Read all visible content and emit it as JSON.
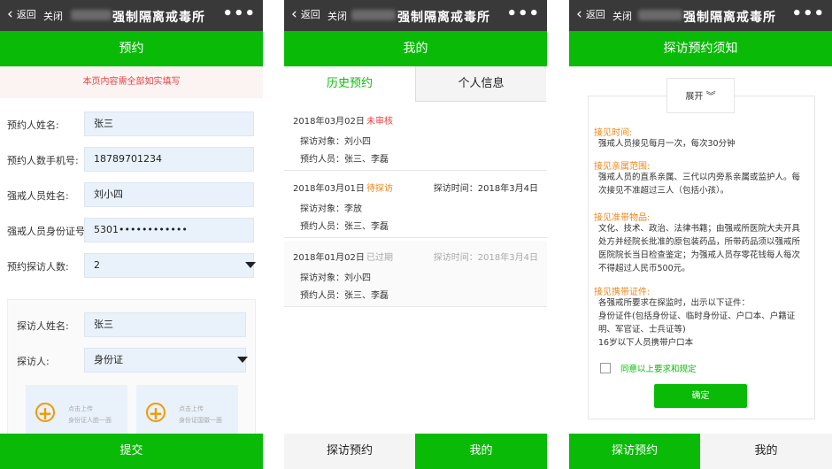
{
  "common": {
    "back": "返回",
    "close": "关闭",
    "window_title": "强制隔离戒毒所",
    "more": "•••"
  },
  "panel1": {
    "header": "预约",
    "notice": "本页内容需全部如实填写",
    "fields": [
      {
        "label": "预约人姓名:",
        "value": "张三"
      },
      {
        "label": "预约人数手机号:",
        "value": "18789701234"
      },
      {
        "label": "强戒人员姓名:",
        "value": "刘小四"
      },
      {
        "label": "强戒人员身份证号:",
        "value": "5301••••••••••••"
      },
      {
        "label": "预约探访人数:",
        "value": "2"
      }
    ],
    "visitor": {
      "name_label": "探访人姓名:",
      "name_value": "张三",
      "type_label": "探访人:",
      "type_value": "身份证",
      "uploads": [
        {
          "line1": "点击上传",
          "line2": "身份证人脸一面"
        },
        {
          "line1": "点击上传",
          "line2": "身份证国徽一面"
        }
      ]
    },
    "submit": "提交"
  },
  "panel2": {
    "header": "我的",
    "tabs": [
      "历史预约",
      "个人信息"
    ],
    "records": [
      {
        "date": "2018年03月02日",
        "status": "未审核",
        "status_color": "#e64340",
        "visit_time": "",
        "target": "探访对象：刘小四",
        "people": "预约人员：张三、李磊"
      },
      {
        "date": "2018年03月01日",
        "status": "待探访",
        "status_color": "#f08519",
        "visit_time": "探访时间：2018年3月4日",
        "target": "探访对象：李放",
        "people": "预约人员：张三、李磊"
      },
      {
        "date": "2018年01月02日",
        "status": "已过期",
        "status_color": "#aaaaaa",
        "visit_time": "探访时间：2018年3月4日",
        "target": "探访对象：刘小四",
        "people": "预约人员：张三、李磊"
      }
    ],
    "nav": [
      "探访预约",
      "我的"
    ]
  },
  "panel3": {
    "header": "探访预约须知",
    "expand": "展开",
    "sections": [
      {
        "title": "接见时间:",
        "body": "强戒人员接见每月一次，每次30分钟"
      },
      {
        "title": "接见亲属范围:",
        "body": "强戒人员的直系亲属、三代以内旁系亲属或监护人。每次接见不准超过三人（包括小孩）。"
      },
      {
        "title": "接见准带物品:",
        "body": "文化、技术、政治、法律书籍；由强戒所医院大夫开具处方并经院长批准的原包装药品，所带药品须以强戒所医院院长当日检查鉴定；为强戒人员存零花钱每人每次不得超过人民币500元。"
      },
      {
        "title": "接见携带证件:",
        "body": "各强戒所要求在探监时，出示以下证件：\n身份证件(包括身份证、临时身份证、户口本、户籍证明、军官证、士兵证等)\n16岁以下人员携带户口本"
      }
    ],
    "agree": "同意以上要求和规定",
    "confirm": "确定",
    "nav": [
      "探访预约",
      "我的"
    ]
  },
  "colors": {
    "green": "#09bb07",
    "topbar": "#393939",
    "warning": "#e64340",
    "orange": "#f08519"
  }
}
